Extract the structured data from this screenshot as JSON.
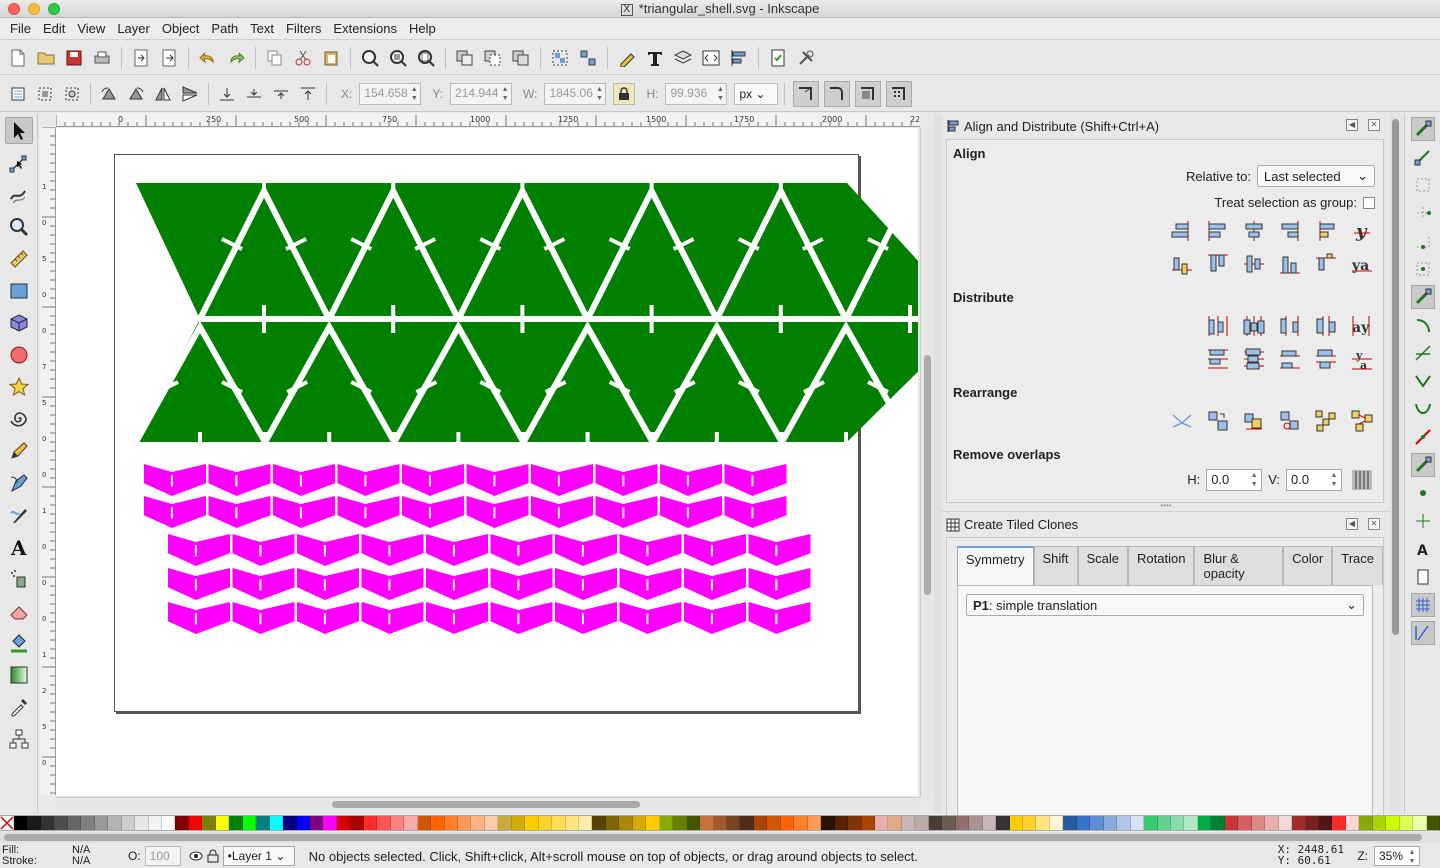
{
  "window": {
    "title": "*triangular_shell.svg - Inkscape"
  },
  "menu": [
    "File",
    "Edit",
    "View",
    "Layer",
    "Object",
    "Path",
    "Text",
    "Filters",
    "Extensions",
    "Help"
  ],
  "toolbar": {
    "x_label": "X:",
    "x_value": "154.658",
    "y_label": "Y:",
    "y_value": "214.944",
    "w_label": "W:",
    "w_value": "1845.06",
    "h_label": "H:",
    "h_value": "99.936",
    "unit": "px"
  },
  "rulers": {
    "h_ticks": [
      "0",
      "250",
      "500",
      "750",
      "1000",
      "1250",
      "1500",
      "1750",
      "2000",
      "2250"
    ],
    "v_ticks": [
      "1",
      "0",
      "5",
      "0",
      "0",
      "7",
      "5",
      "0",
      "0",
      "1",
      "0",
      "0",
      "0",
      "1",
      "2",
      "5",
      "0"
    ]
  },
  "align_panel": {
    "title": "Align and Distribute (Shift+Ctrl+A)",
    "align_heading": "Align",
    "relative_to_label": "Relative to:",
    "relative_to_value": "Last selected",
    "treat_group_label": "Treat selection as group:",
    "distribute_heading": "Distribute",
    "rearrange_heading": "Rearrange",
    "remove_overlaps_heading": "Remove overlaps",
    "h_label": "H:",
    "h_value": "0.0",
    "v_label": "V:",
    "v_value": "0.0"
  },
  "tiled_panel": {
    "title": "Create Tiled Clones",
    "tabs": [
      "Symmetry",
      "Shift",
      "Scale",
      "Rotation",
      "Blur & opacity",
      "Color",
      "Trace"
    ],
    "symmetry_type_bold": "P1",
    "symmetry_type_rest": ": simple translation"
  },
  "status": {
    "fill_label": "Fill:",
    "fill_value": "N/A",
    "stroke_label": "Stroke:",
    "stroke_value": "N/A",
    "opacity_label": "O:",
    "opacity_value": "100",
    "layer": "•Layer 1",
    "message": "No objects selected. Click, Shift+click, Alt+scroll mouse on top of objects, or drag around objects to select.",
    "x_coord": "X: 2448.61",
    "y_coord": "Y:   60.61",
    "zoom_label": "Z:",
    "zoom_value": "35%"
  },
  "colors": {
    "green": "#007f00",
    "magenta": "#ff00ff",
    "accent": "#6a9fd8"
  },
  "palette": [
    "#000000",
    "#1a1a1a",
    "#333333",
    "#4d4d4d",
    "#666666",
    "#808080",
    "#999999",
    "#b3b3b3",
    "#cccccc",
    "#e6e6e6",
    "#f2f2f2",
    "#ffffff",
    "#800000",
    "#ff0000",
    "#808000",
    "#ffff00",
    "#008000",
    "#00ff00",
    "#008080",
    "#00ffff",
    "#000080",
    "#0000ff",
    "#800080",
    "#ff00ff",
    "#d40000",
    "#aa0000",
    "#ff2a2a",
    "#ff5555",
    "#ff8080",
    "#ffaaaa",
    "#d45500",
    "#ff6600",
    "#ff7f2a",
    "#ff9955",
    "#ffb380",
    "#ffccaa",
    "#c8ab37",
    "#d4aa00",
    "#ffcc00",
    "#ffd42a",
    "#ffdd55",
    "#ffe680",
    "#ffeeaa",
    "#554400",
    "#806600",
    "#aa8800",
    "#d4aa00",
    "#ffcc00",
    "#88aa00",
    "#668000",
    "#445500",
    "#c87137",
    "#a05a2c",
    "#784421",
    "#502d16",
    "#aa4400",
    "#d45500",
    "#ff6600",
    "#ff7f2a",
    "#ff9955",
    "#2b1100",
    "#552200",
    "#803300",
    "#aa4400",
    "#e9afaf",
    "#deaa87",
    "#c8b7b7",
    "#bcaaa4",
    "#483e37",
    "#6c5d53",
    "#916f6f",
    "#ac9393",
    "#c8b7b7",
    "#333333",
    "#ffcc00",
    "#ffd42a",
    "#ffe680",
    "#fff6d5",
    "#2c5aa0",
    "#3771c8",
    "#5f8dd3",
    "#87aade",
    "#afc6e9",
    "#d7e3f4",
    "#37c871",
    "#5fd38d",
    "#87deaa",
    "#afe9c6",
    "#00aa44",
    "#008033",
    "#c83737",
    "#d35f5f",
    "#de8787",
    "#e9afaf",
    "#f4d7d7",
    "#a02c2c",
    "#782121",
    "#501616",
    "#ff2a2a",
    "#ffd5d5",
    "#88aa00",
    "#aad400",
    "#ccff00",
    "#ddff55",
    "#eeffaa",
    "#445500"
  ]
}
